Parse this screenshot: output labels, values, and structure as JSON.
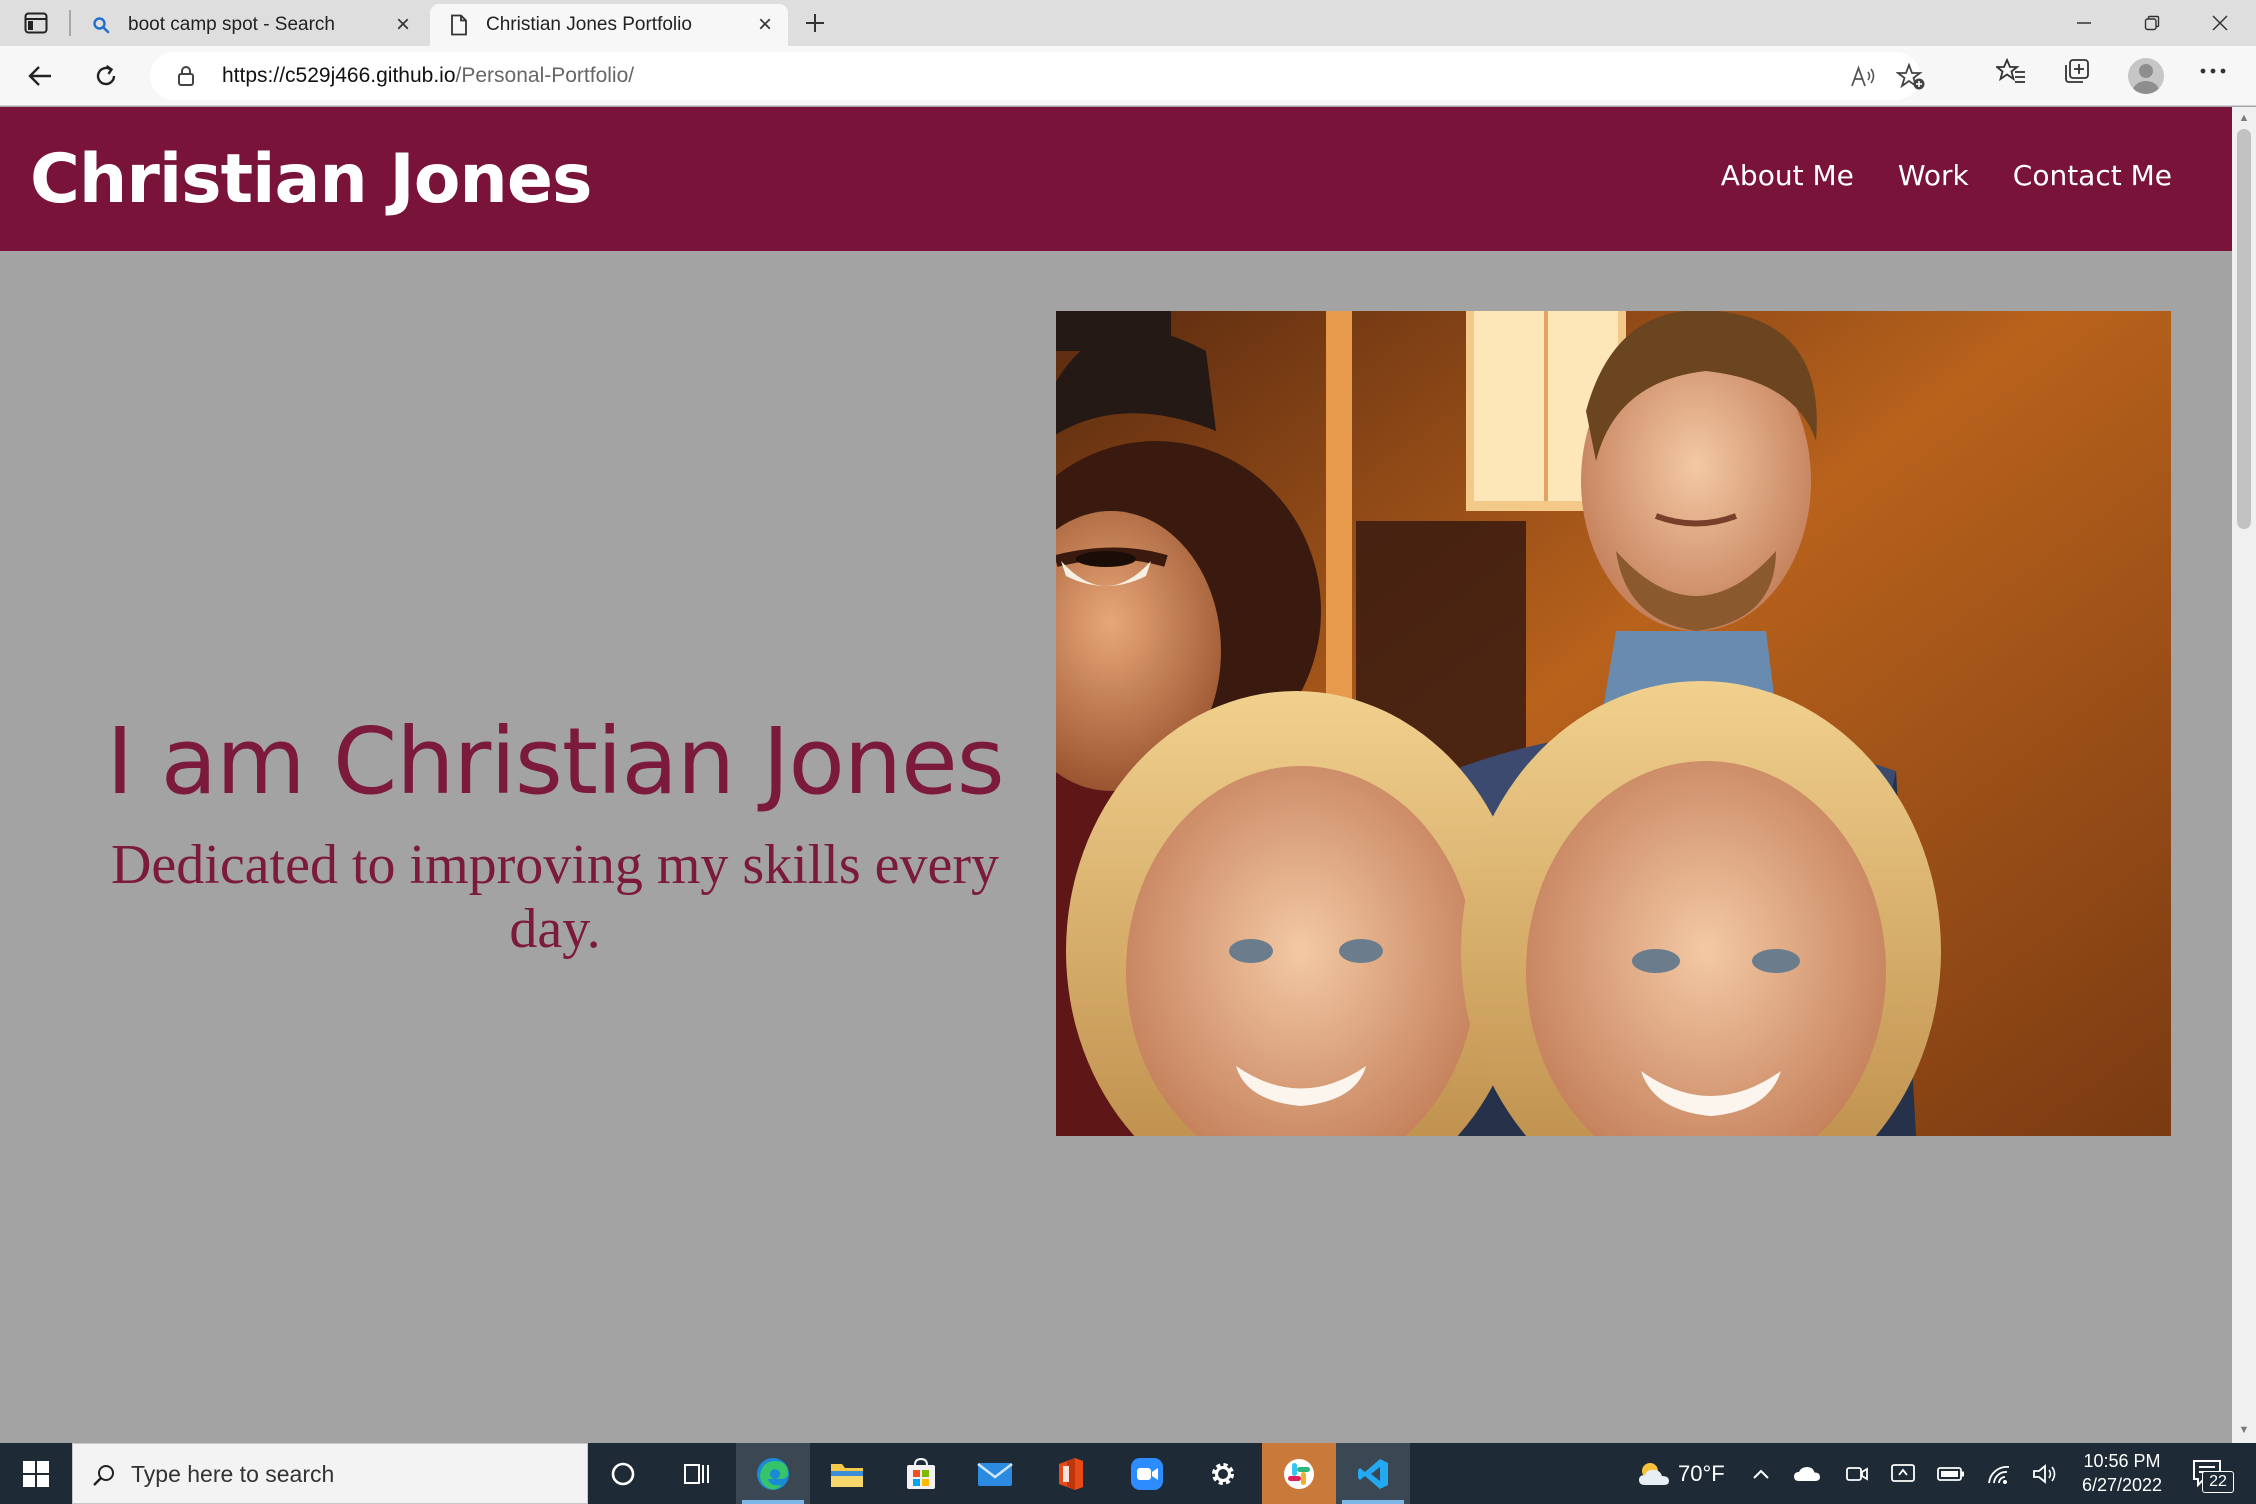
{
  "browser": {
    "tabs": [
      {
        "title": "boot camp spot - Search",
        "icon": "search-icon"
      },
      {
        "title": "Christian Jones Portfolio",
        "icon": "page-icon"
      }
    ],
    "url_domain": "https://c529j466.github.io",
    "url_path": "/Personal-Portfolio/"
  },
  "site": {
    "title": "Christian Jones",
    "nav": [
      "About Me",
      "Work",
      "Contact Me"
    ],
    "heading": "I am Christian Jones",
    "tagline": "Dedicated to improving my skills every day.",
    "photo_icon": "group-photo-image",
    "colors": {
      "header_bg": "#79133a",
      "page_bg": "#a3a3a3",
      "accent_text": "#7b1a3c"
    }
  },
  "taskbar": {
    "search_placeholder": "Type here to search",
    "weather": "70°F",
    "time": "10:56 PM",
    "date": "6/27/2022",
    "notifications": "22"
  }
}
